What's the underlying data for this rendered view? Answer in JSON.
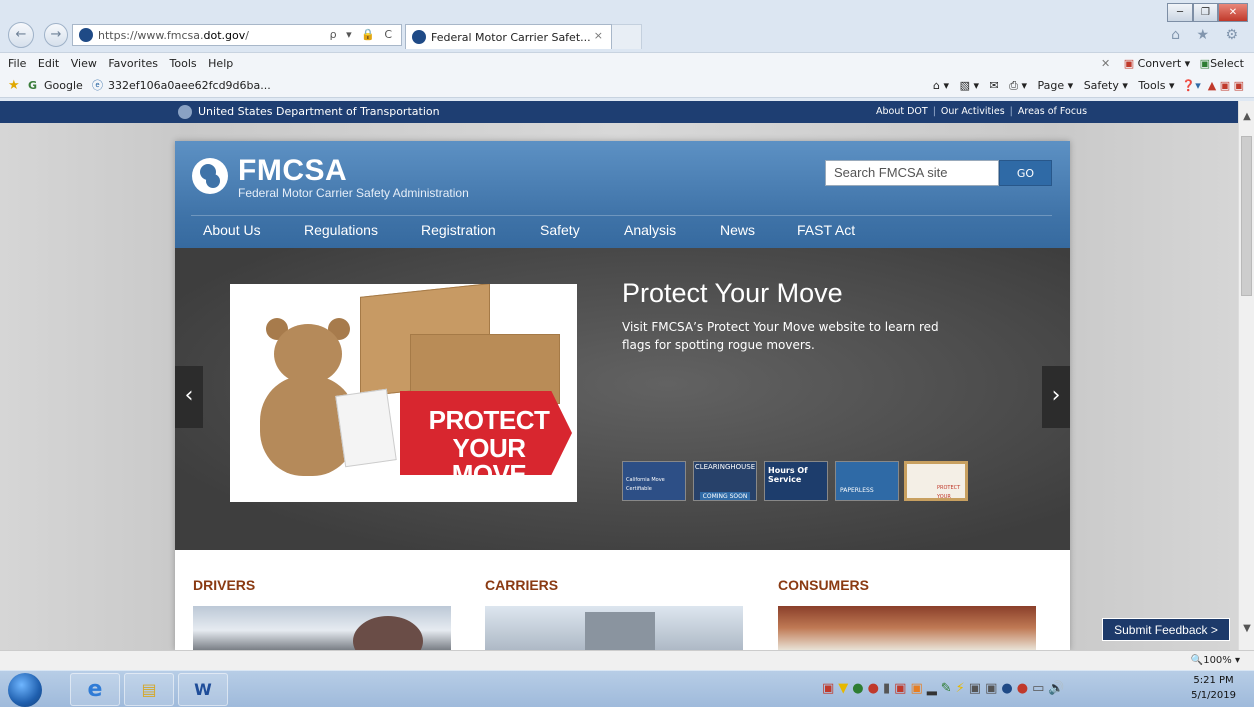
{
  "browser": {
    "url_prefix": "https://www.fmcsa.",
    "url_domain": "dot.gov",
    "url_suffix": "/",
    "addr_controls": "ρ ▾ 🔒 C",
    "tab_title": "Federal Motor Carrier Safet...",
    "tab_close": "×",
    "win_minimize": "─",
    "win_restore": "❐",
    "win_close": "✕",
    "right_icons": "⌂ ★ ⚙",
    "menu": [
      "File",
      "Edit",
      "View",
      "Favorites",
      "Tools",
      "Help"
    ],
    "convert_close": "✕",
    "convert": "Convert",
    "select": "Select",
    "favorites": {
      "google": "Google",
      "bookmark": "332ef106a0aee62fcd9d6ba..."
    },
    "cmdbar": {
      "page": "Page ▾",
      "safety": "Safety ▾",
      "tools": "Tools ▾"
    },
    "zoom": "100%"
  },
  "dot_bar": {
    "name": "United States Department of Transportation",
    "links": [
      "About DOT",
      "Our Activities",
      "Areas of Focus"
    ]
  },
  "site": {
    "logo": "FMCSA",
    "logo_sub": "Federal Motor Carrier Safety Administration",
    "search_placeholder": "Search FMCSA site",
    "go": "GO",
    "nav": [
      "About Us",
      "Regulations",
      "Registration",
      "Safety",
      "Analysis",
      "News",
      "FAST Act"
    ]
  },
  "hero": {
    "title": "Protect Your Move",
    "description": "Visit FMCSA’s Protect Your Move website to learn red flags for spotting rogue movers.",
    "sign_line1": "PROTECT",
    "sign_line2": "YOUR MOVE",
    "prev": "‹",
    "next": "›",
    "thumbs": [
      {
        "label": "California Move Certifiable",
        "bg": "#2d4f86"
      },
      {
        "label": "CLEARINGHOUSE",
        "sub": "COMING SOON",
        "bg": "#27416a"
      },
      {
        "label": "Hours Of Service",
        "bg": "#1d3d6c"
      },
      {
        "label": "PAPERLESS",
        "bg": "#2f6aa6"
      },
      {
        "label": "PROTECT YOUR MOVE",
        "bg": "#f4efe6"
      }
    ]
  },
  "sections": [
    "DRIVERS",
    "CARRIERS",
    "CONSUMERS"
  ],
  "feedback": "Submit Feedback >",
  "taskbar": {
    "time": "5:21 PM",
    "date": "5/1/2019"
  },
  "colors": {
    "dot_blue": "#1e3e72",
    "header_blue": "#3f73a8",
    "section_red": "#8a3a12"
  }
}
